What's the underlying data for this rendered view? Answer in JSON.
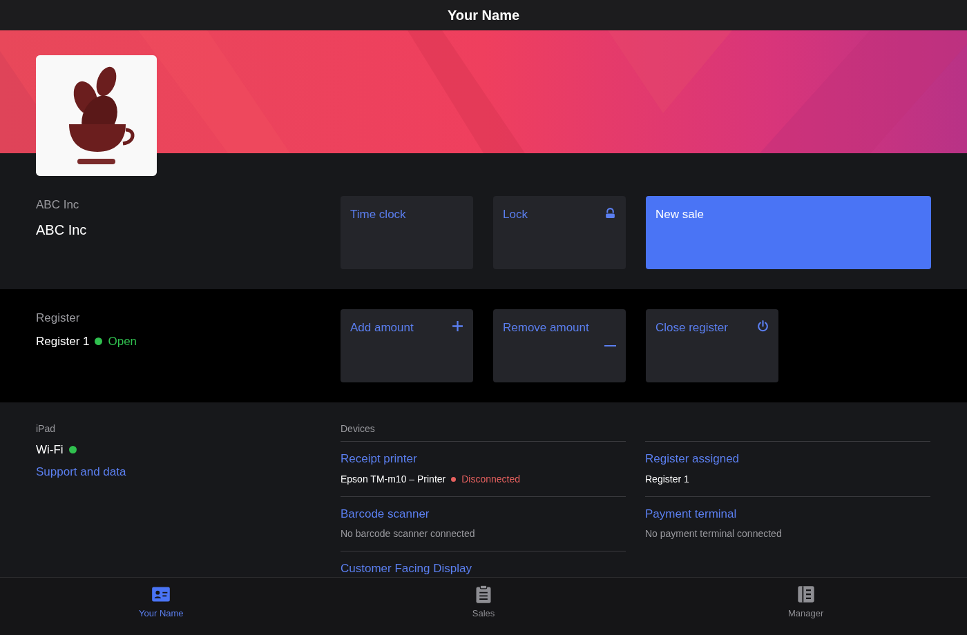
{
  "header": {
    "title": "Your Name"
  },
  "company": {
    "label": "ABC Inc",
    "name": "ABC Inc"
  },
  "company_actions": [
    {
      "label": "Time clock",
      "kind": "tile"
    },
    {
      "label": "Lock",
      "kind": "tile"
    },
    {
      "label": "New sale",
      "kind": "primary"
    }
  ],
  "register": {
    "label": "Register",
    "name": "Register 1",
    "status": "Open",
    "color": "#30c04f"
  },
  "register_actions": [
    {
      "label": "Add amount",
      "kind": "tile"
    },
    {
      "label": "Remove amount",
      "kind": "tile"
    },
    {
      "label": "Close register",
      "kind": "tile"
    }
  ],
  "ipad": {
    "label": "iPad",
    "wifi": "Wi-Fi",
    "wifi_connected": true,
    "support_link": "Support and data"
  },
  "devices": {
    "title": "Devices",
    "columns": [
      [
        {
          "title": "Receipt printer",
          "detail": "Epson TM-m10 – Printer",
          "status": "Disconnected",
          "color": "#e5605e"
        },
        {
          "title": "Barcode scanner",
          "detail": "No barcode scanner connected"
        },
        {
          "title": "Customer Facing Display"
        }
      ],
      [
        {
          "title": "Register assigned",
          "detail": "Register 1"
        },
        {
          "title": "Payment terminal",
          "detail": "No payment terminal connected"
        }
      ]
    ]
  },
  "tabs": [
    {
      "label": "Your Name",
      "selected": true
    },
    {
      "label": "Sales",
      "selected": false
    },
    {
      "label": "Manager",
      "selected": false
    }
  ]
}
